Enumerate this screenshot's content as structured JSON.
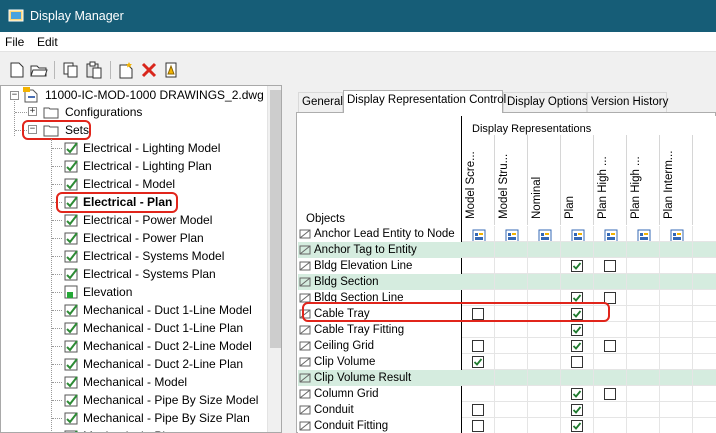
{
  "window": {
    "title": "Display Manager"
  },
  "menu": [
    "File",
    "Edit"
  ],
  "toolbar": {
    "icons": [
      "new-icon",
      "open-icon",
      "copy-icon",
      "paste-icon",
      "new-style-icon",
      "delete-icon",
      "purge-icon"
    ]
  },
  "tree": {
    "root": "11000-IC-MOD-1000 DRAWINGS_2.dwg",
    "configurations": "Configurations",
    "sets": "Sets",
    "items": [
      {
        "label": "Electrical - Lighting Model",
        "bold": false,
        "highlight": false
      },
      {
        "label": "Electrical - Lighting Plan",
        "bold": false,
        "highlight": false
      },
      {
        "label": "Electrical - Model",
        "bold": false,
        "highlight": false
      },
      {
        "label": "Electrical - Plan",
        "bold": true,
        "highlight": true
      },
      {
        "label": "Electrical - Power Model",
        "bold": false,
        "highlight": false
      },
      {
        "label": "Electrical - Power Plan",
        "bold": false,
        "highlight": false
      },
      {
        "label": "Electrical - Systems Model",
        "bold": false,
        "highlight": false
      },
      {
        "label": "Electrical - Systems Plan",
        "bold": false,
        "highlight": false
      },
      {
        "label": "Elevation",
        "bold": false,
        "highlight": false
      },
      {
        "label": "Mechanical - Duct 1-Line Model",
        "bold": false,
        "highlight": false
      },
      {
        "label": "Mechanical - Duct 1-Line Plan",
        "bold": false,
        "highlight": false
      },
      {
        "label": "Mechanical - Duct 2-Line Model",
        "bold": false,
        "highlight": false
      },
      {
        "label": "Mechanical - Duct 2-Line Plan",
        "bold": false,
        "highlight": false
      },
      {
        "label": "Mechanical - Model",
        "bold": false,
        "highlight": false
      },
      {
        "label": "Mechanical - Pipe By Size Model",
        "bold": false,
        "highlight": false
      },
      {
        "label": "Mechanical - Pipe By Size Plan",
        "bold": false,
        "highlight": false
      },
      {
        "label": "Mechanical - Pla",
        "bold": false,
        "highlight": false
      }
    ]
  },
  "tabs": [
    {
      "label": "General",
      "active": false
    },
    {
      "label": "Display Representation Control",
      "active": true
    },
    {
      "label": "Display Options",
      "active": false
    },
    {
      "label": "Version History",
      "active": false
    }
  ],
  "grid": {
    "group_header": "Display Representations",
    "objects_header": "Objects",
    "columns": [
      "Model Scre...",
      "Model Stru...",
      "Nominal",
      "Plan",
      "Plan High ...",
      "Plan High ...",
      "Plan Interm...",
      ""
    ],
    "rows": [
      {
        "name": "Anchor Lead Entity to Node",
        "icon": "anchor-lead-icon",
        "green": false,
        "checks": [
          null,
          null,
          null,
          null,
          null,
          null,
          null,
          null
        ]
      },
      {
        "name": "Anchor Tag to Entity",
        "icon": "anchor-tag-icon",
        "green": true,
        "checks": [
          null,
          null,
          null,
          null,
          null,
          null,
          null,
          null
        ]
      },
      {
        "name": "Bldg Elevation Line",
        "icon": "elevation-line-icon",
        "green": false,
        "checks": [
          null,
          null,
          null,
          true,
          false,
          null,
          null,
          null
        ]
      },
      {
        "name": "Bldg Section",
        "icon": "bldg-section-icon",
        "green": true,
        "checks": [
          null,
          null,
          null,
          null,
          null,
          null,
          null,
          null
        ]
      },
      {
        "name": "Bldg Section Line",
        "icon": "section-line-icon",
        "green": false,
        "checks": [
          null,
          null,
          null,
          true,
          false,
          null,
          null,
          null
        ]
      },
      {
        "name": "Cable Tray",
        "icon": "cable-tray-icon",
        "green": false,
        "checks": [
          false,
          null,
          null,
          true,
          null,
          null,
          null,
          null
        ]
      },
      {
        "name": "Cable Tray Fitting",
        "icon": "cable-tray-fitting-icon",
        "green": false,
        "checks": [
          null,
          null,
          null,
          true,
          null,
          null,
          null,
          null
        ]
      },
      {
        "name": "Ceiling Grid",
        "icon": "ceiling-grid-icon",
        "green": false,
        "checks": [
          false,
          null,
          null,
          true,
          false,
          null,
          null,
          null
        ]
      },
      {
        "name": "Clip Volume",
        "icon": "clip-volume-icon",
        "green": false,
        "checks": [
          true,
          null,
          null,
          false,
          null,
          null,
          null,
          null
        ]
      },
      {
        "name": "Clip Volume Result",
        "icon": "clip-volume-result-icon",
        "green": true,
        "checks": [
          null,
          null,
          null,
          null,
          null,
          null,
          null,
          null
        ]
      },
      {
        "name": "Column Grid",
        "icon": "column-grid-icon",
        "green": false,
        "checks": [
          null,
          null,
          null,
          true,
          false,
          null,
          null,
          null
        ]
      },
      {
        "name": "Conduit",
        "icon": "conduit-icon",
        "green": false,
        "checks": [
          false,
          null,
          null,
          true,
          null,
          null,
          null,
          null
        ]
      },
      {
        "name": "Conduit Fitting",
        "icon": "conduit-fitting-icon",
        "green": false,
        "checks": [
          false,
          null,
          null,
          true,
          null,
          null,
          null,
          null
        ]
      }
    ]
  },
  "colors": {
    "titlebar": "#165d77",
    "highlight_box": "#e1251b",
    "green_row": "#d5ecdf"
  }
}
